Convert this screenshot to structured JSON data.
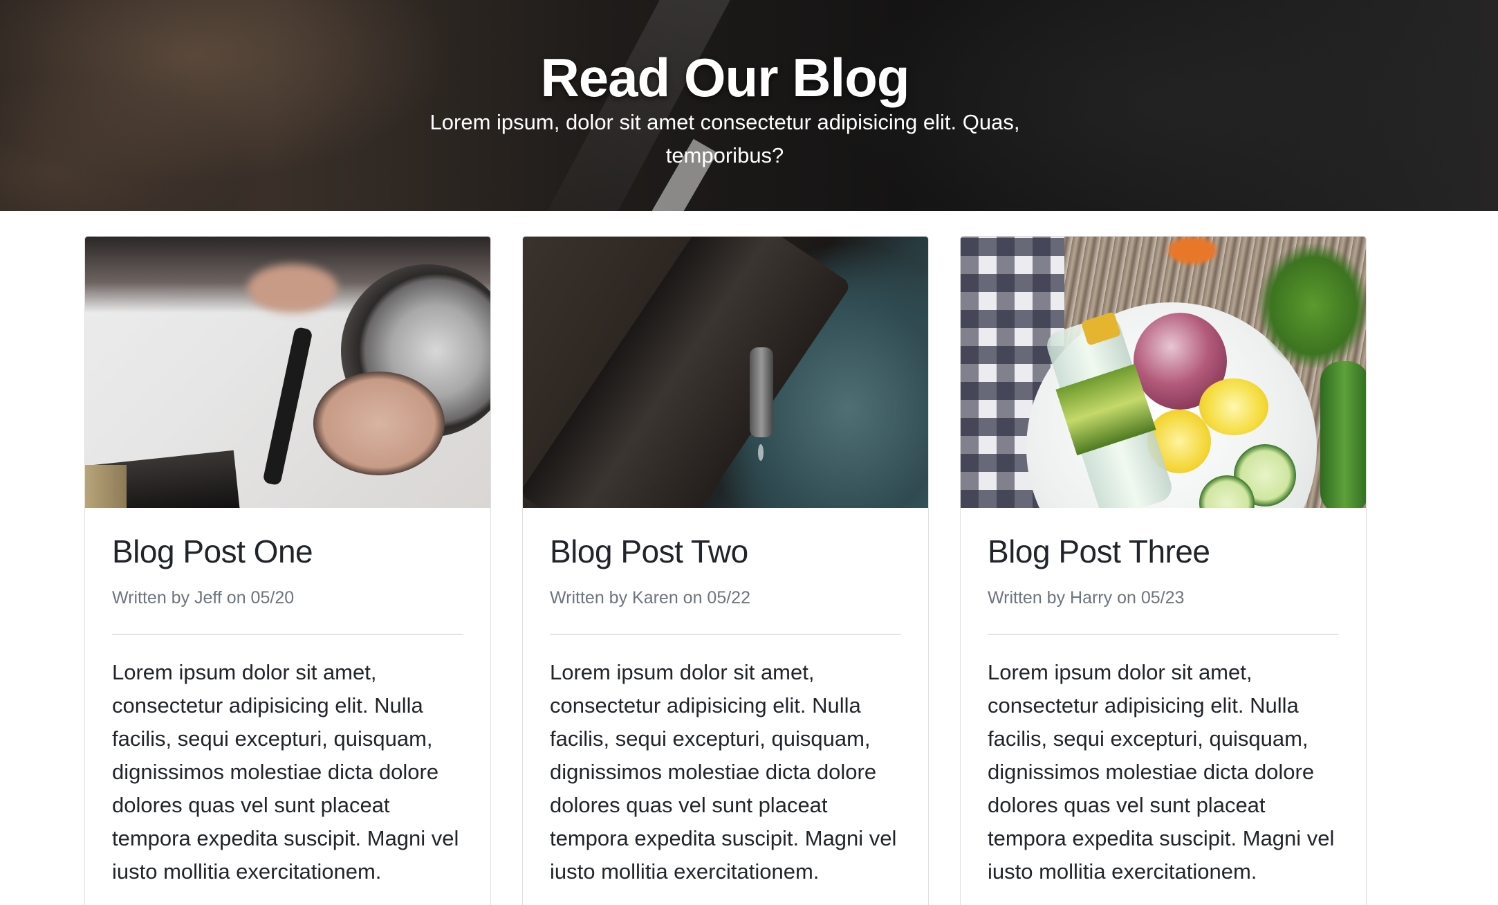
{
  "hero": {
    "title": "Read Our Blog",
    "subtitle": "Lorem ipsum, dolor sit amet consectetur adipisicing elit. Quas, temporibus?"
  },
  "posts": [
    {
      "title": "Blog Post One",
      "meta": "Written by Jeff on 05/20",
      "body": "Lorem ipsum dolor sit amet, consectetur adipisicing elit. Nulla facilis, sequi excepturi, quisquam, dignissimos molestiae dicta dolore dolores quas vel sunt placeat tempora expedita suscipit. Magni vel iusto mollitia exercitationem."
    },
    {
      "title": "Blog Post Two",
      "meta": "Written by Karen on 05/22",
      "body": "Lorem ipsum dolor sit amet, consectetur adipisicing elit. Nulla facilis, sequi excepturi, quisquam, dignissimos molestiae dicta dolore dolores quas vel sunt placeat tempora expedita suscipit. Magni vel iusto mollitia exercitationem."
    },
    {
      "title": "Blog Post Three",
      "meta": "Written by Harry on 05/23",
      "body": "Lorem ipsum dolor sit amet, consectetur adipisicing elit. Nulla facilis, sequi excepturi, quisquam, dignissimos molestiae dicta dolore dolores quas vel sunt placeat tempora expedita suscipit. Magni vel iusto mollitia exercitationem."
    }
  ],
  "colors": {
    "title_text": "#212529",
    "meta_text": "#6c757d",
    "hero_text": "#ffffff"
  }
}
